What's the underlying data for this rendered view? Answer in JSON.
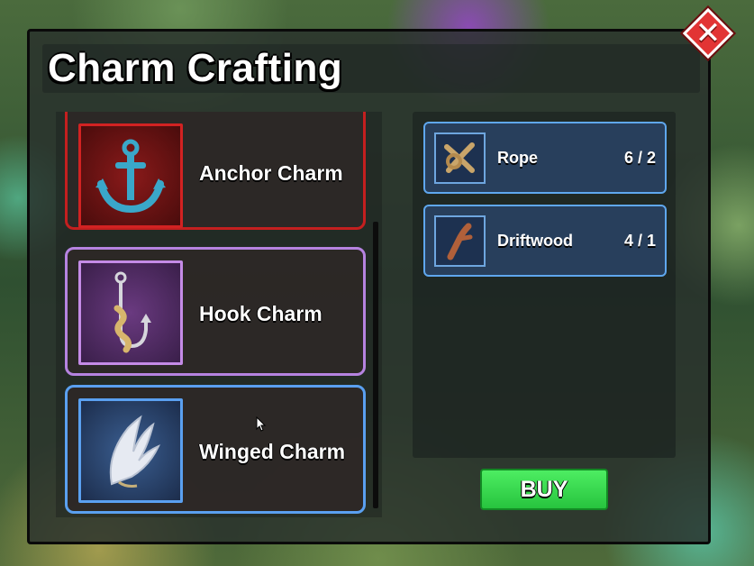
{
  "window": {
    "title": "Charm Crafting",
    "close_glyph": "✕"
  },
  "charms": [
    {
      "name": "Anchor Charm",
      "rarity_color": "#c41f1f",
      "icon": "anchor-icon"
    },
    {
      "name": "Hook Charm",
      "rarity_color": "#b583e0",
      "icon": "hook-icon"
    },
    {
      "name": "Winged Charm",
      "rarity_color": "#5aa0f0",
      "icon": "wing-icon"
    }
  ],
  "requirements": [
    {
      "name": "Rope",
      "count": "6 / 2",
      "icon": "rope-icon"
    },
    {
      "name": "Driftwood",
      "count": "4 / 1",
      "icon": "driftwood-icon"
    }
  ],
  "buy": {
    "label": "BUY",
    "color": "#27c43e"
  }
}
